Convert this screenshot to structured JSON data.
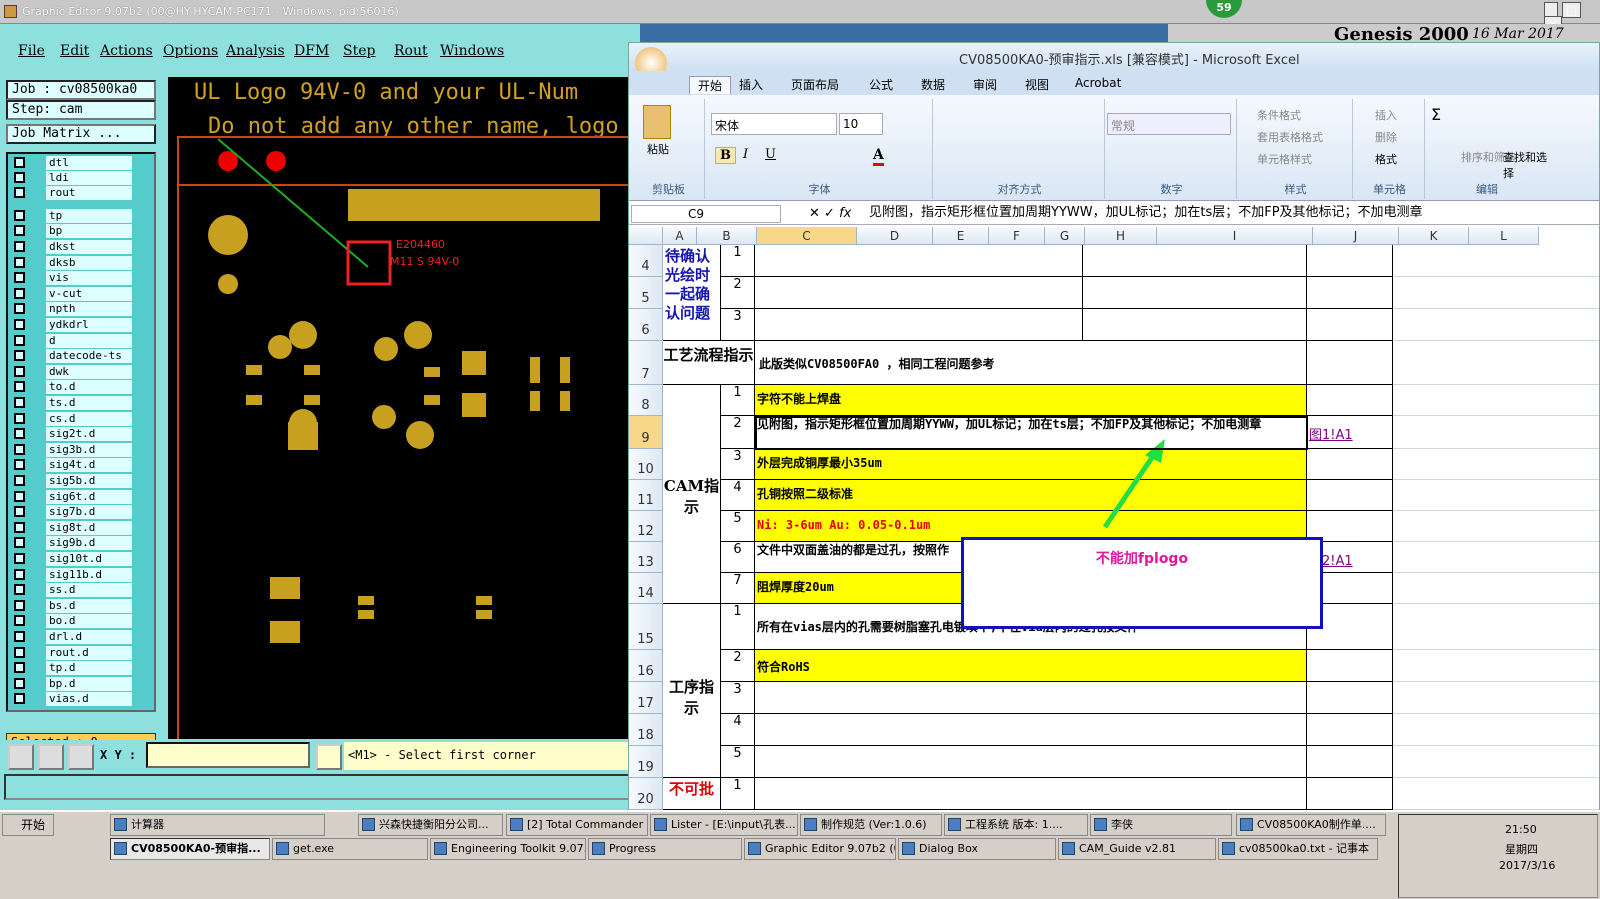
{
  "ge": {
    "title": "Graphic Editor 9.07b2 (00@HY-HYCAM-PC171 - Windows, pid:56016)",
    "menu": [
      "File",
      "Edit",
      "Actions",
      "Options",
      "Analysis",
      "DFM",
      "Step",
      "Rout",
      "Windows"
    ],
    "job": "Job : cv08500ka0",
    "step": "Step: cam",
    "job_matrix": "Job Matrix ...",
    "layers": [
      "dtl",
      "ldi",
      "rout",
      "tp",
      "bp",
      "dkst",
      "dksb",
      "vis",
      "v-cut",
      "npth",
      "ydkdrl",
      "d",
      "datecode-ts",
      "dwk",
      "to.d",
      "ts.d",
      "cs.d",
      "sig2t.d",
      "sig3b.d",
      "sig4t.d",
      "sig5b.d",
      "sig6t.d",
      "sig7b.d",
      "sig8t.d",
      "sig9b.d",
      "sig10t.d",
      "sig11b.d",
      "ss.d",
      "bs.d",
      "bo.d",
      "drl.d",
      "rout.d",
      "tp.d",
      "bp.d",
      "vias.d"
    ],
    "selected": "Selected : 0",
    "xy_label": "X Y :",
    "status": "<M1> - Select first corner",
    "canvas_text1": "UL Logo 94V-0 and your UL-Num",
    "canvas_text2": "Do not add any other name, logo",
    "ul_text1": "E204460",
    "ul_text2": "M11 S 94V-0"
  },
  "genesis": "Genesis 2000",
  "genesis_date": "16 Mar 2017",
  "badge": "59",
  "excel": {
    "title": "CV08500KA0-预审指示.xls  [兼容模式] - Microsoft Excel",
    "tabs": [
      "开始",
      "插入",
      "页面布局",
      "公式",
      "数据",
      "审阅",
      "视图",
      "Acrobat"
    ],
    "ribbon": {
      "paste": "粘贴",
      "clipboard": "剪贴板",
      "font_name": "宋体",
      "font_size": "10",
      "font": "字体",
      "align": "对齐方式",
      "number_format": "常规",
      "number": "数字",
      "cond_format": "条件格式",
      "table_format": "套用表格格式",
      "cell_style": "单元格样式",
      "style": "样式",
      "insert": "插入",
      "delete": "删除",
      "format": "格式",
      "cells": "单元格",
      "sort": "排序和筛选",
      "find": "查找和选择",
      "edit": "编辑"
    },
    "namebox": "C9",
    "formula": "见附图，指示矩形框位置加周期YYWW，加UL标记；加在ts层；不加FP及其他标记；不加电测章",
    "cols": [
      "A",
      "B",
      "C",
      "D",
      "E",
      "F",
      "G",
      "H",
      "I",
      "J",
      "K",
      "L"
    ],
    "rows": [
      "4",
      "5",
      "6",
      "7",
      "8",
      "9",
      "10",
      "11",
      "12",
      "13",
      "14",
      "15",
      "16",
      "17",
      "18",
      "19",
      "20"
    ],
    "a_top": "待确认光绘时一起确认问题",
    "a_flow": "工艺流程指示",
    "a_cam": "CAM指示",
    "a_proc": "工序指示",
    "a_last": "不可批",
    "flow_text": "此版类似CV08500FA0 ，相同工程问题参考",
    "cam": [
      [
        "1",
        "字符不能上焊盘"
      ],
      [
        "2",
        "见附图，指示矩形框位置加周期YYWW，加UL标记；加在ts层；不加FP及其他标记；不加电测章"
      ],
      [
        "3",
        "外层完成铜厚最小35um"
      ],
      [
        "4",
        "孔铜按照二级标准"
      ],
      [
        "5",
        "Ni: 3-6um Au: 0.05-0.1um"
      ],
      [
        "6",
        "文件中双面盖油的都是过孔，按照作"
      ],
      [
        "7",
        "阻焊厚度20um"
      ]
    ],
    "proc": [
      [
        "1",
        "所有在vias层内的孔需要树脂塞孔电镀填平,不在via层内的过孔按文件"
      ],
      [
        "2",
        "符合RoHS"
      ],
      [
        "3",
        ""
      ],
      [
        "4",
        ""
      ],
      [
        "5",
        ""
      ]
    ],
    "top_nums": [
      "1",
      "2",
      "3"
    ],
    "last_num": "1",
    "link1": "图1!A1",
    "link2": "图2!A1",
    "popup": "不能加fplogo"
  },
  "taskbar": {
    "start": "开始",
    "row1": [
      "计算器",
      "兴森快捷衡阳分公司...",
      "[2] Total Commander ...",
      "Lister - [E:\\input\\孔表...",
      "制作规范 (Ver:1.0.6)",
      "工程系统  版本: 1....",
      "李侠",
      "CV08500KA0制作单...."
    ],
    "row2": [
      "CV08500KA0-预审指...",
      "get.exe",
      "Engineering Toolkit 9.07...",
      "Progress",
      "Graphic Editor 9.07b2 (0...",
      "Dialog Box",
      "CAM_Guide v2.81",
      "cv08500ka0.txt - 记事本"
    ],
    "time": "21:50",
    "weekday": "星期四",
    "date": "2017/3/16"
  }
}
